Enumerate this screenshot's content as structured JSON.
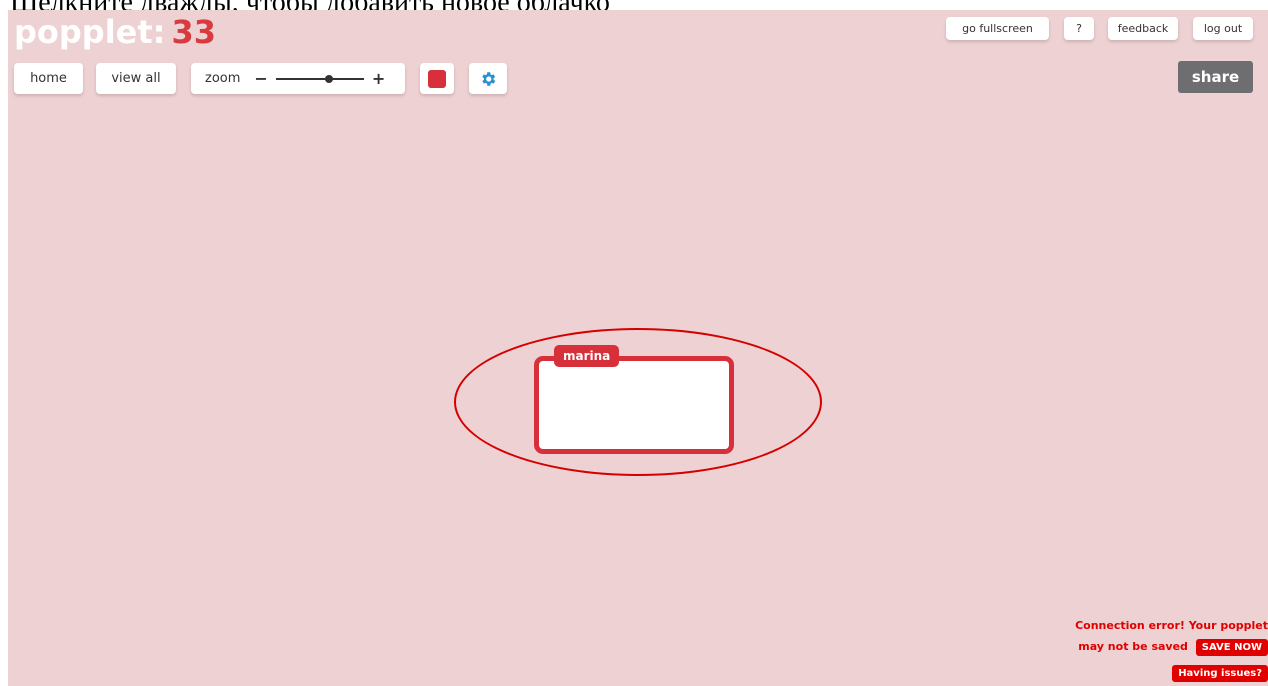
{
  "caption": "Щелкните дважды, чтобы добавить новое облачко",
  "logo": {
    "name": "popplet",
    "sep": ":",
    "count": "33"
  },
  "top_links": {
    "fullscreen": "go fullscreen",
    "help": "?",
    "feedback": "feedback",
    "logout": "log out"
  },
  "toolbar": {
    "home": "home",
    "view_all": "view all",
    "zoom_label": "zoom",
    "zoom_minus": "−",
    "zoom_plus": "+",
    "zoom_level": 0.6
  },
  "share": "share",
  "popple": {
    "author": "marina"
  },
  "error": {
    "line1": "Connection error! Your popplet",
    "line2": "may not be saved",
    "save_now": "SAVE NOW",
    "issues": "Having issues?"
  },
  "colors": {
    "canvas": "#eed1d2",
    "accent": "#d8303a",
    "error": "#e00000"
  },
  "icons": {
    "settings": "gear-icon",
    "color": "color-swatch-icon"
  }
}
